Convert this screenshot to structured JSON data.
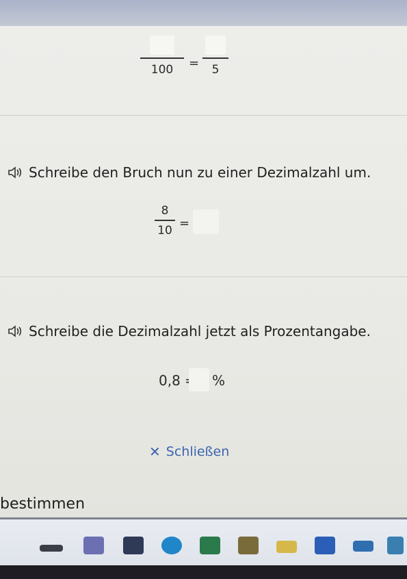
{
  "fraction_row": {
    "den1": "100",
    "equals": "=",
    "den2": "5"
  },
  "task1": {
    "instruction": "Schreibe den Bruch nun zu einer Dezimalzahl um.",
    "numerator": "8",
    "denominator": "10",
    "equals": "="
  },
  "task2": {
    "instruction": "Schreibe die Dezimalzahl jetzt als Prozentangabe.",
    "expression": "0,8 =",
    "percent": "%"
  },
  "close_button": {
    "label": "Schließen"
  },
  "bottom_text": "bestimmen",
  "colors": {
    "link": "#3b64b0",
    "text": "#1f1f1f",
    "background": "#ededea"
  },
  "taskbar": {
    "icons": [
      "file-icon",
      "teams-icon",
      "launcher-icon",
      "edge-icon",
      "calculator-icon",
      "game-icon",
      "folder-icon",
      "word-icon",
      "mail-icon",
      "app-icon"
    ]
  }
}
